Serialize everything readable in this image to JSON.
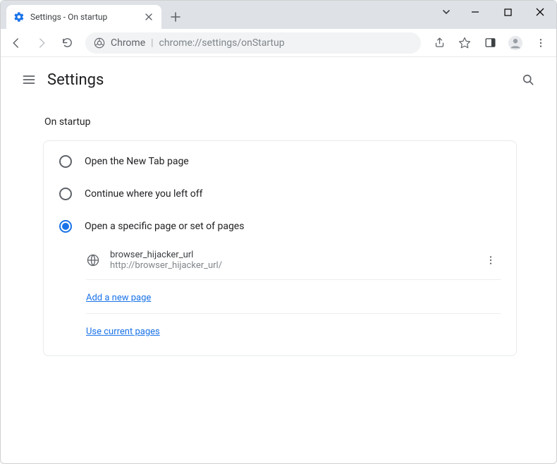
{
  "tab": {
    "title": "Settings - On startup"
  },
  "omnibox": {
    "prefix": "Chrome",
    "url": "chrome://settings/onStartup"
  },
  "header": {
    "title": "Settings"
  },
  "section": {
    "heading": "On startup",
    "options": [
      {
        "label": "Open the New Tab page"
      },
      {
        "label": "Continue where you left off"
      },
      {
        "label": "Open a specific page or set of pages"
      }
    ],
    "selected_index": 2,
    "pages": [
      {
        "name": "browser_hijacker_url",
        "url": "http://browser_hijacker_url/"
      }
    ],
    "links": {
      "add_page": "Add a new page",
      "use_current": "Use current pages"
    }
  }
}
